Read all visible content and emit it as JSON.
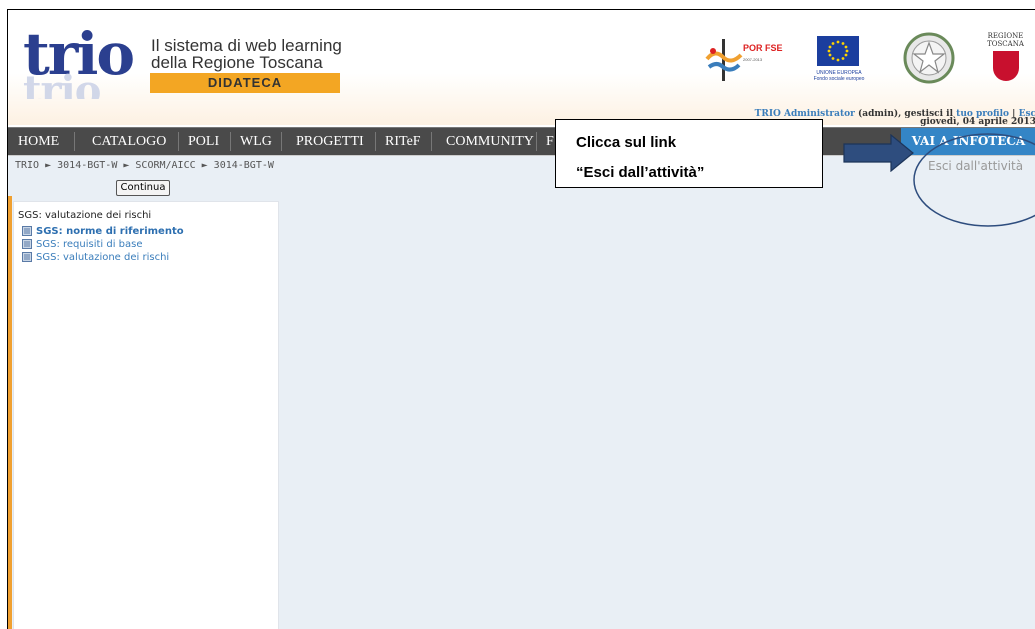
{
  "header": {
    "logo_text": "trio",
    "tagline_line1": "Il sistema di web learning",
    "tagline_line2": "della Regione Toscana",
    "section_badge": "DIDATECA",
    "por_title": "POR FSE",
    "por_years": "2007-2013",
    "eu_label": "UNIONE EUROPEA",
    "eu_sublabel": "Fondo sociale europeo",
    "toscana_label_1": "REGIONE",
    "toscana_label_2": "TOSCANA",
    "user_name": "TRIO Administrator",
    "user_role": "(admin), gestisci il",
    "profile_link": "tuo profilo",
    "separator": "|",
    "logout_link": "Esc",
    "date": "giovedì, 04 aprile 2013"
  },
  "nav": {
    "items": [
      "HOME",
      "CATALOGO",
      "POLI",
      "WLG",
      "PROGETTI",
      "RITeF",
      "COMMUNITY",
      "F"
    ],
    "infoteca": "VAI A INFOTECA"
  },
  "breadcrumb": "TRIO ► 3014-BGT-W ► SCORM/AICC ► 3014-BGT-W",
  "continue_button": "Continua",
  "exit_link": "Esci dall'attività",
  "tree": {
    "root": "SGS: valutazione dei rischi",
    "nodes": [
      {
        "label": "SGS: norme di riferimento",
        "active": true
      },
      {
        "label": "SGS: requisiti di base",
        "active": false
      },
      {
        "label": "SGS: valutazione dei rischi",
        "active": false
      }
    ]
  },
  "callout": {
    "line1": "Clicca sul link",
    "line2": "“Esci dall’attività”"
  },
  "colors": {
    "nav_bg": "#4a4a4a",
    "infoteca_bg": "#3485c6",
    "badge_bg": "#f3a623",
    "content_bg": "#e9eff5",
    "arrow": "#2e4d7e"
  }
}
